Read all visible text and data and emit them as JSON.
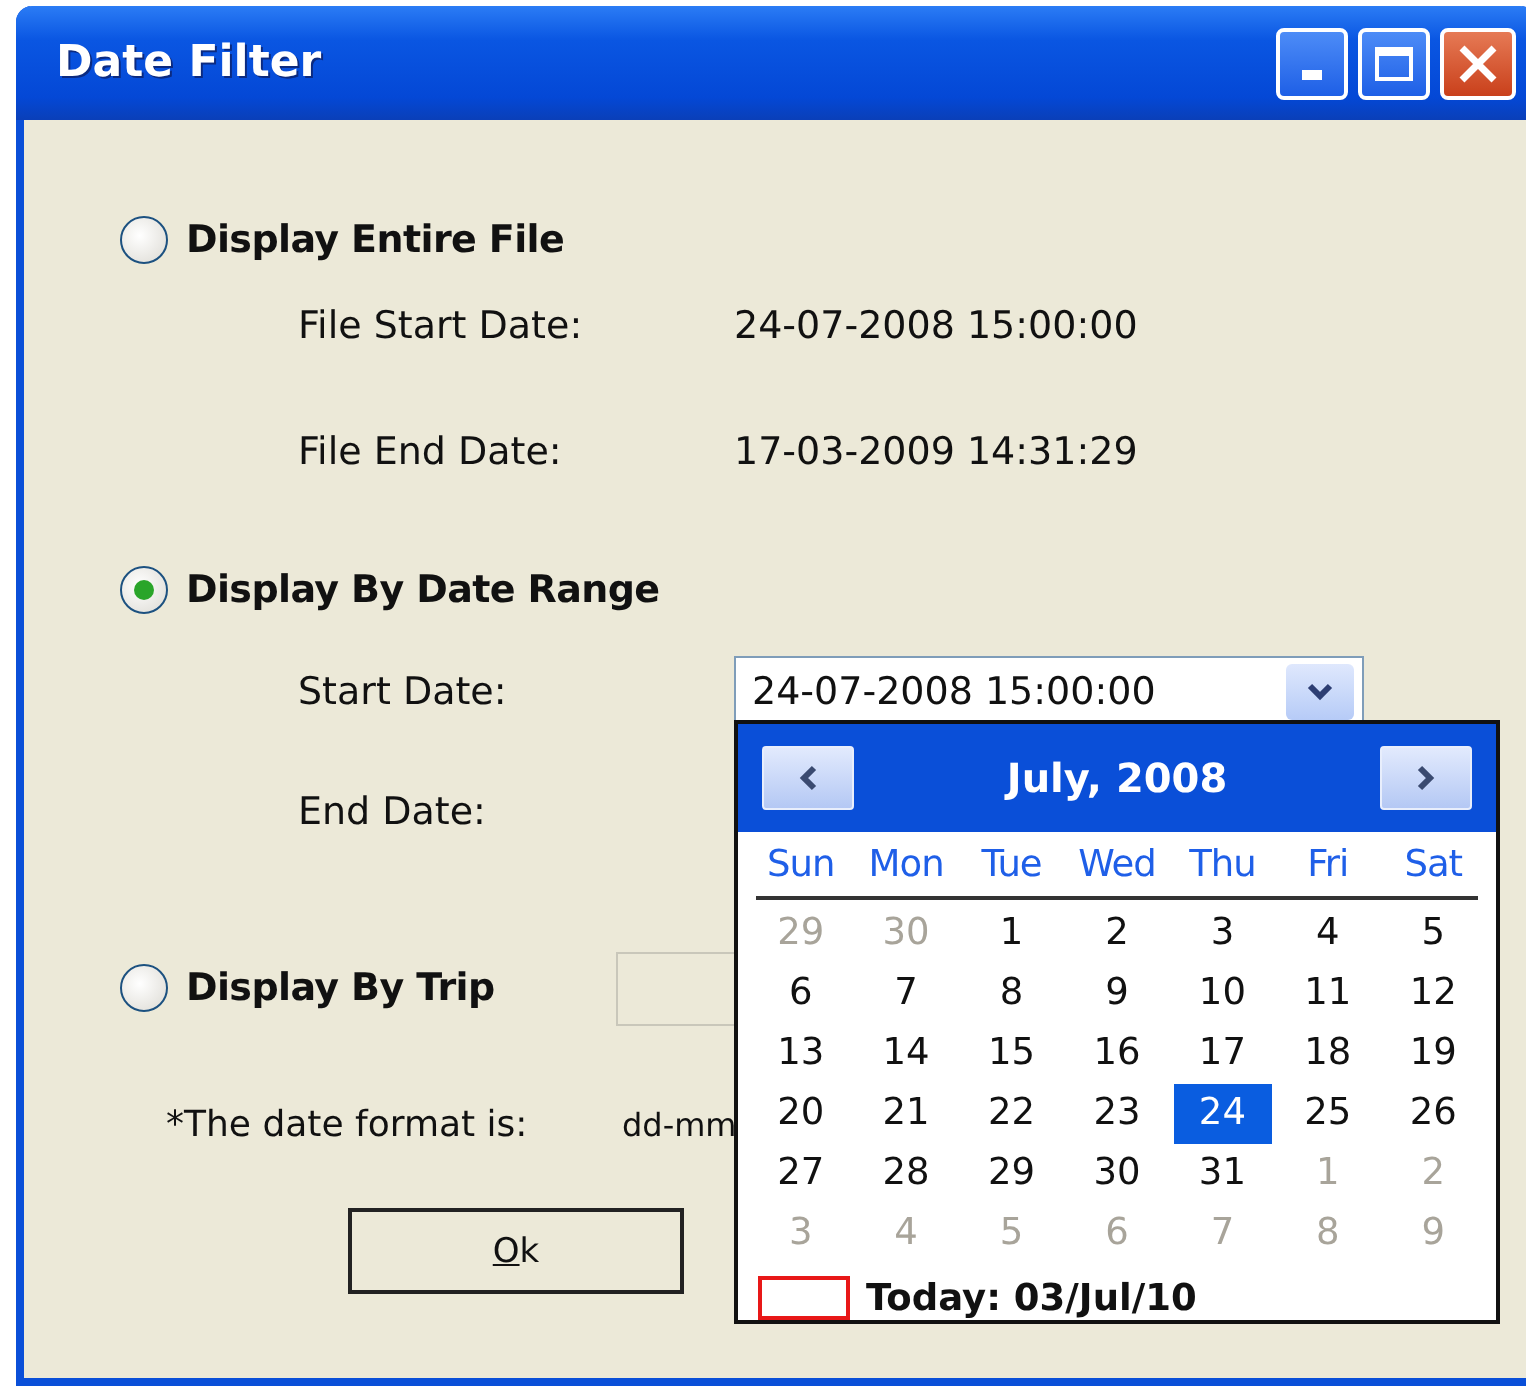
{
  "window": {
    "title": "Date Filter"
  },
  "options": [
    {
      "label": "Display Entire File",
      "selected": false,
      "details": [
        {
          "label": "File Start Date:",
          "value": "24-07-2008 15:00:00"
        },
        {
          "label": "File End Date:",
          "value": "17-03-2009 14:31:29"
        }
      ]
    },
    {
      "label": "Display By Date Range",
      "selected": true,
      "fields": [
        {
          "label": "Start Date:",
          "value": "24-07-2008 15:00:00",
          "dropdown": true
        },
        {
          "label": "End Date:"
        }
      ]
    },
    {
      "label": "Display By Trip",
      "selected": false,
      "fields": [
        {
          "disabled": true
        }
      ]
    }
  ],
  "note": {
    "label": "*The date format is:",
    "value": "dd-mm"
  },
  "calendar": {
    "title": "July, 2008",
    "weekdays": [
      "Sun",
      "Mon",
      "Tue",
      "Wed",
      "Thu",
      "Fri",
      "Sat"
    ],
    "weeks": [
      [
        {
          "day": "29",
          "other_month": true,
          "selected": false
        },
        {
          "day": "30",
          "other_month": true,
          "selected": false
        },
        {
          "day": "1",
          "other_month": false,
          "selected": false
        },
        {
          "day": "2",
          "other_month": false,
          "selected": false
        },
        {
          "day": "3",
          "other_month": false,
          "selected": false
        },
        {
          "day": "4",
          "other_month": false,
          "selected": false
        },
        {
          "day": "5",
          "other_month": false,
          "selected": false
        }
      ],
      [
        {
          "day": "6",
          "other_month": false,
          "selected": false
        },
        {
          "day": "7",
          "other_month": false,
          "selected": false
        },
        {
          "day": "8",
          "other_month": false,
          "selected": false
        },
        {
          "day": "9",
          "other_month": false,
          "selected": false
        },
        {
          "day": "10",
          "other_month": false,
          "selected": false
        },
        {
          "day": "11",
          "other_month": false,
          "selected": false
        },
        {
          "day": "12",
          "other_month": false,
          "selected": false
        }
      ],
      [
        {
          "day": "13",
          "other_month": false,
          "selected": false
        },
        {
          "day": "14",
          "other_month": false,
          "selected": false
        },
        {
          "day": "15",
          "other_month": false,
          "selected": false
        },
        {
          "day": "16",
          "other_month": false,
          "selected": false
        },
        {
          "day": "17",
          "other_month": false,
          "selected": false
        },
        {
          "day": "18",
          "other_month": false,
          "selected": false
        },
        {
          "day": "19",
          "other_month": false,
          "selected": false
        }
      ],
      [
        {
          "day": "20",
          "other_month": false,
          "selected": false
        },
        {
          "day": "21",
          "other_month": false,
          "selected": false
        },
        {
          "day": "22",
          "other_month": false,
          "selected": false
        },
        {
          "day": "23",
          "other_month": false,
          "selected": false
        },
        {
          "day": "24",
          "other_month": false,
          "selected": true
        },
        {
          "day": "25",
          "other_month": false,
          "selected": false
        },
        {
          "day": "26",
          "other_month": false,
          "selected": false
        }
      ],
      [
        {
          "day": "27",
          "other_month": false,
          "selected": false
        },
        {
          "day": "28",
          "other_month": false,
          "selected": false
        },
        {
          "day": "29",
          "other_month": false,
          "selected": false
        },
        {
          "day": "30",
          "other_month": false,
          "selected": false
        },
        {
          "day": "31",
          "other_month": false,
          "selected": false
        },
        {
          "day": "1",
          "other_month": true,
          "selected": false
        },
        {
          "day": "2",
          "other_month": true,
          "selected": false
        }
      ],
      [
        {
          "day": "3",
          "other_month": true,
          "selected": false
        },
        {
          "day": "4",
          "other_month": true,
          "selected": false
        },
        {
          "day": "5",
          "other_month": true,
          "selected": false
        },
        {
          "day": "6",
          "other_month": true,
          "selected": false
        },
        {
          "day": "7",
          "other_month": true,
          "selected": false
        },
        {
          "day": "8",
          "other_month": true,
          "selected": false
        },
        {
          "day": "9",
          "other_month": true,
          "selected": false
        }
      ]
    ],
    "today": "Today: 03/Jul/10"
  },
  "buttons": [
    {
      "label": "Ok",
      "mnemonic": true
    }
  ]
}
